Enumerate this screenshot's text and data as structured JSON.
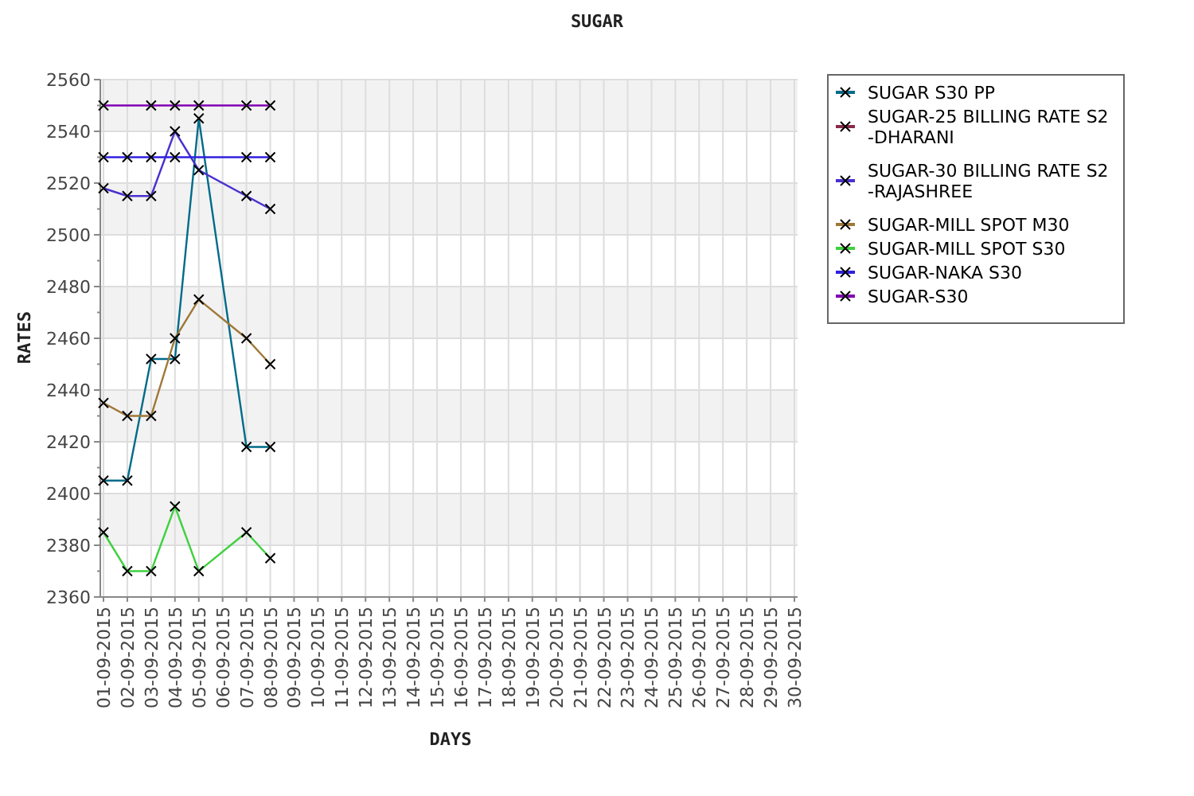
{
  "chart_data": {
    "type": "line",
    "title": "SUGAR",
    "xlabel": "DAYS",
    "ylabel": "RATES",
    "grid": true,
    "legend": true,
    "categories": [
      "01-09-2015",
      "02-09-2015",
      "03-09-2015",
      "04-09-2015",
      "05-09-2015",
      "06-09-2015",
      "07-09-2015",
      "08-09-2015",
      "09-09-2015",
      "10-09-2015",
      "11-09-2015",
      "12-09-2015",
      "13-09-2015",
      "14-09-2015",
      "15-09-2015",
      "16-09-2015",
      "17-09-2015",
      "18-09-2015",
      "19-09-2015",
      "20-09-2015",
      "21-09-2015",
      "22-09-2015",
      "23-09-2015",
      "24-09-2015",
      "25-09-2015",
      "26-09-2015",
      "27-09-2015",
      "28-09-2015",
      "29-09-2015",
      "30-09-2015"
    ],
    "ylim": [
      2360,
      2560
    ],
    "yticks": [
      2360,
      2380,
      2400,
      2420,
      2440,
      2460,
      2480,
      2500,
      2520,
      2540,
      2560
    ],
    "series": [
      {
        "name": "SUGAR S30 PP",
        "color": "#006b8a",
        "marker": "x",
        "values": [
          2405,
          2405,
          2452,
          2452,
          2545,
          null,
          2418,
          2418,
          null,
          null,
          null,
          null,
          null,
          null,
          null,
          null,
          null,
          null,
          null,
          null,
          null,
          null,
          null,
          null,
          null,
          null,
          null,
          null,
          null,
          null
        ]
      },
      {
        "name": "SUGAR-25 BILLING RATE S2 -DHARANI",
        "color": "#8a2a4a",
        "marker": "x",
        "values": [
          null,
          null,
          null,
          null,
          null,
          null,
          null,
          null,
          null,
          null,
          null,
          null,
          null,
          null,
          null,
          null,
          null,
          null,
          null,
          null,
          null,
          null,
          null,
          null,
          null,
          null,
          null,
          null,
          null,
          null
        ]
      },
      {
        "name": "SUGAR-30 BILLING RATE S2 -RAJASHREE",
        "color": "#4a30d0",
        "marker": "x",
        "values": [
          2518,
          2515,
          2515,
          2540,
          2525,
          null,
          2515,
          2510,
          null,
          null,
          null,
          null,
          null,
          null,
          null,
          null,
          null,
          null,
          null,
          null,
          null,
          null,
          null,
          null,
          null,
          null,
          null,
          null,
          null,
          null
        ]
      },
      {
        "name": "SUGAR-MILL SPOT M30",
        "color": "#a07838",
        "marker": "x",
        "values": [
          2435,
          2430,
          2430,
          2460,
          2475,
          null,
          2460,
          2450,
          null,
          null,
          null,
          null,
          null,
          null,
          null,
          null,
          null,
          null,
          null,
          null,
          null,
          null,
          null,
          null,
          null,
          null,
          null,
          null,
          null,
          null
        ]
      },
      {
        "name": "SUGAR-MILL SPOT S30",
        "color": "#40d040",
        "marker": "x",
        "values": [
          2385,
          2370,
          2370,
          2395,
          2370,
          null,
          2385,
          2375,
          null,
          null,
          null,
          null,
          null,
          null,
          null,
          null,
          null,
          null,
          null,
          null,
          null,
          null,
          null,
          null,
          null,
          null,
          null,
          null,
          null,
          null
        ]
      },
      {
        "name": "SUGAR-NAKA S30",
        "color": "#3020e0",
        "marker": "x",
        "values": [
          2530,
          2530,
          2530,
          2530,
          null,
          null,
          2530,
          2530,
          null,
          null,
          null,
          null,
          null,
          null,
          null,
          null,
          null,
          null,
          null,
          null,
          null,
          null,
          null,
          null,
          null,
          null,
          null,
          null,
          null,
          null
        ]
      },
      {
        "name": "SUGAR-S30",
        "color": "#8000b0",
        "marker": "x",
        "values": [
          2550,
          null,
          2550,
          2550,
          2550,
          null,
          2550,
          2550,
          null,
          null,
          null,
          null,
          null,
          null,
          null,
          null,
          null,
          null,
          null,
          null,
          null,
          null,
          null,
          null,
          null,
          null,
          null,
          null,
          null,
          null
        ]
      }
    ]
  }
}
